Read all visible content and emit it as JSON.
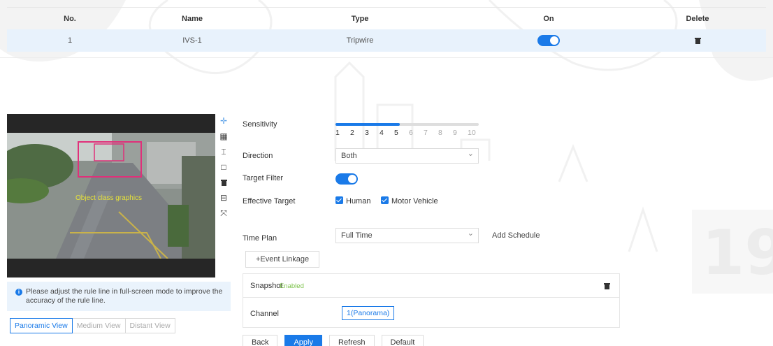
{
  "table": {
    "headers": {
      "no": "No.",
      "name": "Name",
      "type": "Type",
      "on": "On",
      "delete": "Delete"
    },
    "rows": [
      {
        "no": "1",
        "name": "IVS-1",
        "type": "Tripwire",
        "on": true
      }
    ]
  },
  "preview": {
    "tools": [
      "crosshair-icon",
      "grid-icon",
      "line-icon",
      "rectangle-icon",
      "trash-icon",
      "target-size-icon",
      "fullscreen-icon"
    ],
    "overlay_label": "Object class graphics",
    "tip": "Please adjust the rule line in full-screen mode to improve the accuracy of the rule line.",
    "views": [
      "Panoramic View",
      "Medium View",
      "Distant View"
    ],
    "active_view": "Panoramic View"
  },
  "form": {
    "sensitivity_label": "Sensitivity",
    "sensitivity_ticks": [
      "1",
      "2",
      "3",
      "4",
      "5",
      "6",
      "7",
      "8",
      "9",
      "10"
    ],
    "sensitivity_value": 5,
    "direction_label": "Direction",
    "direction_value": "Both",
    "target_filter_label": "Target Filter",
    "target_filter_on": true,
    "effective_target_label": "Effective Target",
    "targets": [
      "Human",
      "Motor Vehicle"
    ],
    "time_plan_label": "Time Plan",
    "time_plan_value": "Full Time",
    "add_schedule": "Add Schedule",
    "event_linkage": "+Event Linkage",
    "snapshot_label": "Snapshot",
    "snapshot_status": "Enabled",
    "channel_label": "Channel",
    "channel_value": "1(Panorama)"
  },
  "actions": {
    "back": "Back",
    "apply": "Apply",
    "refresh": "Refresh",
    "default": "Default"
  },
  "colors": {
    "accent": "#1a7ae8",
    "row_highlight": "#e8f2fc",
    "rule_box": "#e0307a",
    "enabled": "#7cc24a"
  }
}
